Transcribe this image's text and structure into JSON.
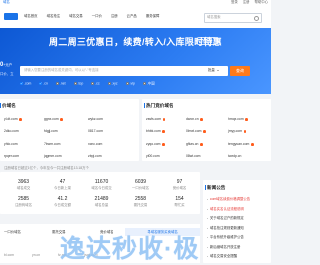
{
  "topbar": {
    "brand": "域名",
    "links": [
      "登录",
      "注册",
      "帮助中心"
    ]
  },
  "nav": {
    "items": [
      "域名首页",
      "域名抢注",
      "域名交易",
      "一口价",
      "注册",
      "云产品",
      "服务保障"
    ],
    "search_placeholder": "域名搜索"
  },
  "hero": {
    "headline": "周二周三优惠日，续费/转入/入库限时特惠",
    "cta": "立即查看 ›",
    "side_price": "0",
    "side_price_unit": "+元户",
    "side_tag": "口价，立",
    "query_placeholder": "请输入您要注册的域名或关键词，可以以“-”号连接",
    "query_option": "批量",
    "query_button": "查询",
    "tlds": [
      ".com",
      ".cn",
      ".net",
      ".top",
      ".cc",
      ".xyz",
      ".vip",
      ".中国"
    ]
  },
  "fixed_domains": {
    "title": "价域名",
    "items": [
      "yl.dt.com",
      "ggnx.com",
      "wykz.com",
      "2dko.com",
      "fdgjj.com",
      "0817.com",
      "yhlo.com",
      "7bwm.com",
      "xcnc.com",
      "rpqer.com",
      "jqgmm.com",
      "zbpj.com"
    ],
    "hot": [
      0,
      1
    ]
  },
  "hot_recommend": {
    "title": "热门竞价域名",
    "items": [
      "zssfs.com",
      "dwon.cn",
      "hmqx.com",
      "bhbk.com",
      "0lmxt.com",
      "jmyy.com",
      "zyqo.com",
      "gfkzs.cn",
      "tengyuan.com",
      "yl00.com",
      "08wt.com",
      "twzdp.cn"
    ],
    "hot": [
      0,
      1,
      2,
      3,
      4,
      5,
      6,
      7,
      8
    ]
  },
  "notice": "注册域名已超过1亿个，今年至今一共注册域名13.18万个",
  "stats": [
    {
      "num": "3963",
      "label": "域名成交"
    },
    {
      "num": "47",
      "label": "今日新上架"
    },
    {
      "num": "11670",
      "label": "域名今日成交"
    },
    {
      "num": "6039",
      "label": "一口价域名"
    },
    {
      "num": "97",
      "label": "竞价域名"
    },
    {
      "num": "2585",
      "label": "注册商域名"
    },
    {
      "num": "41.2",
      "label": "今日成交额"
    },
    {
      "num": "21489",
      "label": "域名总量"
    },
    {
      "num": "2558",
      "label": "委托交易"
    },
    {
      "num": "154",
      "label": "帮忙买"
    }
  ],
  "news": {
    "title": "新闻公告",
    "items": [
      {
        "text": "com域名续费价格调整公告",
        "hot": true
      },
      {
        "text": "域名实名认证流程说明",
        "hot": true
      },
      {
        "text": "关于域名过户的新规定",
        "hot": false
      },
      {
        "text": "域名抢注规则更新通知",
        "hot": false
      },
      {
        "text": "平台系统升级维护公告",
        "hot": false
      },
      {
        "text": "新后缀域名开放注册",
        "hot": false
      },
      {
        "text": "域名交易安全提醒",
        "hot": false
      }
    ]
  },
  "bottom": {
    "cols": [
      "一口价域名",
      "委托交易",
      "竞价域名"
    ],
    "banner": "寻域名服务买卖域名",
    "ticker": [
      "bl.com",
      "yn.cn",
      "fz.net",
      "jsqjj.com"
    ]
  },
  "watermark": "逸达秒收·极"
}
